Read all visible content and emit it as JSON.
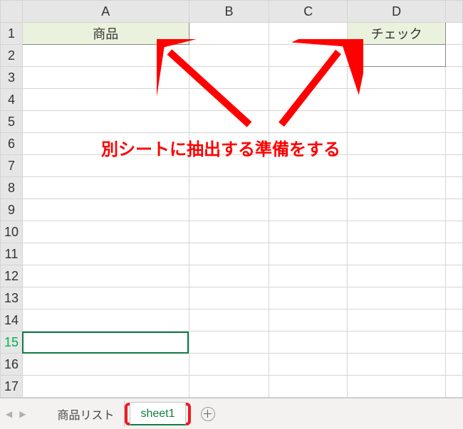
{
  "columns": [
    "A",
    "B",
    "C",
    "D"
  ],
  "row_count": 17,
  "selected_row": 15,
  "cells": {
    "A1": "商品",
    "D1": "チェック"
  },
  "annotation": {
    "text": "別シートに抽出する準備をする"
  },
  "tabs": {
    "nav_prev": "◀",
    "nav_next": "▶",
    "items": [
      {
        "label": "商品リスト",
        "active": false
      },
      {
        "label": "sheet1",
        "active": true
      }
    ],
    "add": "＋"
  }
}
